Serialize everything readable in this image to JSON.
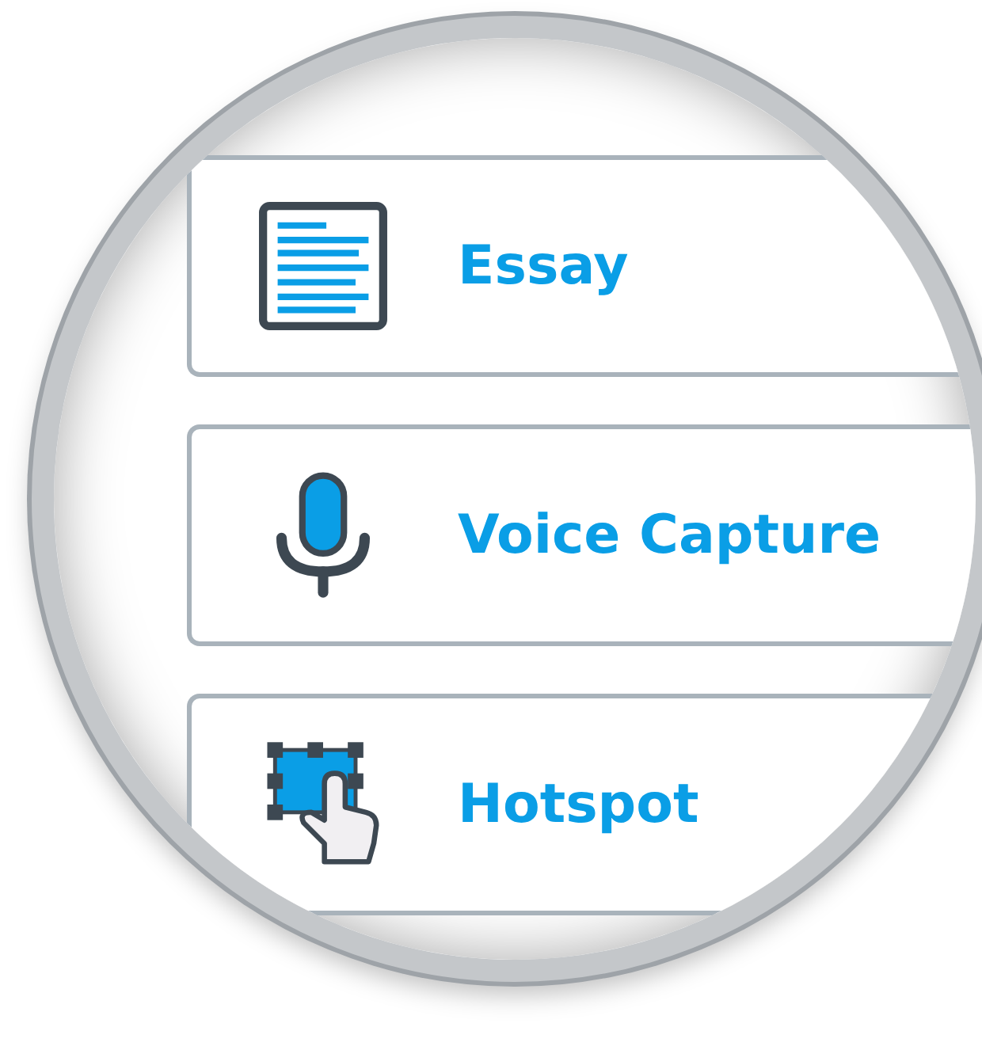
{
  "options": [
    {
      "kind": "essay",
      "label": "Essay"
    },
    {
      "kind": "voice",
      "label": "Voice Capture"
    },
    {
      "kind": "hotspot",
      "label": "Hotspot"
    }
  ]
}
